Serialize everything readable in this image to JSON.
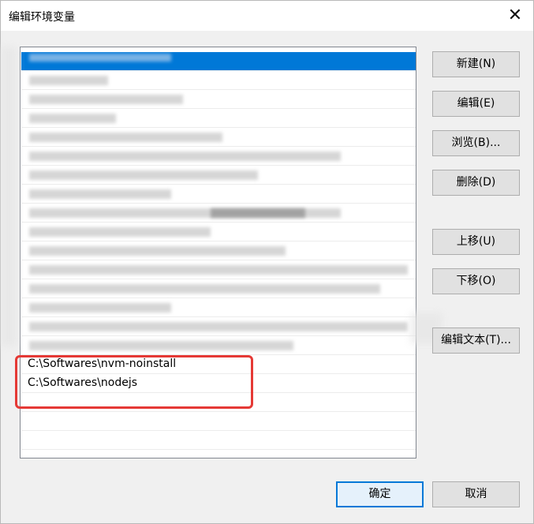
{
  "window": {
    "title": "编辑环境变量",
    "close_icon": "close-icon"
  },
  "list": {
    "rows": [
      {
        "text": "",
        "selected": true
      },
      {
        "text": ""
      },
      {
        "text": ""
      },
      {
        "text": ""
      },
      {
        "text": ""
      },
      {
        "text": ""
      },
      {
        "text": ""
      },
      {
        "text": ""
      },
      {
        "text": ""
      },
      {
        "text": ""
      },
      {
        "text": ""
      },
      {
        "text": ""
      },
      {
        "text": ""
      },
      {
        "text": ""
      },
      {
        "text": ""
      },
      {
        "text": ""
      },
      {
        "text": "C:\\Softwares\\nvm-noinstall"
      },
      {
        "text": "C:\\Softwares\\nodejs"
      },
      {
        "text": ""
      },
      {
        "text": ""
      },
      {
        "text": ""
      }
    ]
  },
  "buttons": {
    "new": "新建(N)",
    "edit": "编辑(E)",
    "browse": "浏览(B)...",
    "delete": "删除(D)",
    "move_up": "上移(U)",
    "move_down": "下移(O)",
    "edit_text": "编辑文本(T)...",
    "ok": "确定",
    "cancel": "取消"
  },
  "colors": {
    "selection": "#0078d7",
    "highlight": "#e53935"
  }
}
